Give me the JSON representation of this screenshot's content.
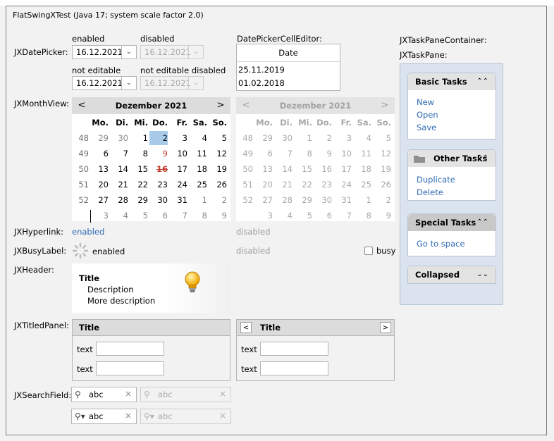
{
  "window": {
    "title": "FlatSwingXTest (Java 17;  system scale factor 2.0)"
  },
  "labels": {
    "datepicker": "JXDatePicker:",
    "monthview": "JXMonthView:",
    "hyperlink": "JXHyperlink:",
    "busylabel": "JXBusyLabel:",
    "header": "JXHeader:",
    "titledpanel": "JXTitledPanel:",
    "searchfield": "JXSearchField:",
    "taskpanecontainer": "JXTaskPaneContainer:",
    "taskpane": "JXTaskPane:"
  },
  "datepicker": {
    "enabled_label": "enabled",
    "disabled_label": "disabled",
    "not_editable_label": "not editable",
    "not_editable_disabled_label": "not editable disabled",
    "value": "16.12.2021"
  },
  "cell_editor": {
    "label": "DatePickerCellEditor:",
    "header": "Date",
    "rows": [
      "25.11.2019",
      "01.02.2018"
    ]
  },
  "monthview": {
    "title": "Dezember 2021",
    "prev": "<",
    "next": ">",
    "days": [
      "Mo.",
      "Di.",
      "Mi.",
      "Do.",
      "Fr.",
      "Sa.",
      "So."
    ],
    "weeks": [
      [
        "48",
        "29",
        "30",
        "1",
        "2",
        "3",
        "4",
        "5"
      ],
      [
        "49",
        "6",
        "7",
        "8",
        "9",
        "10",
        "11",
        "12"
      ],
      [
        "50",
        "13",
        "14",
        "15",
        "16",
        "17",
        "18",
        "19"
      ],
      [
        "51",
        "20",
        "21",
        "22",
        "23",
        "24",
        "25",
        "26"
      ],
      [
        "52",
        "27",
        "28",
        "29",
        "30",
        "31",
        "1",
        "2"
      ],
      [
        "",
        "3",
        "4",
        "5",
        "6",
        "7",
        "8",
        "9"
      ]
    ]
  },
  "hyperlink": {
    "enabled": "enabled",
    "disabled": "disabled"
  },
  "busylabel": {
    "enabled": "enabled",
    "disabled": "disabled",
    "busy_label": "busy"
  },
  "header": {
    "title": "Title",
    "desc1": "Description",
    "desc2": "More description"
  },
  "titledpanel": {
    "title": "Title",
    "field_label": "text",
    "prev": "<",
    "next": ">"
  },
  "searchfield": {
    "value": "abc",
    "clear": "×"
  },
  "taskpanes": [
    {
      "title": "Basic Tasks",
      "toggle": "≈",
      "links": [
        "New",
        "Open",
        "Save"
      ]
    },
    {
      "title": "Other Tasks",
      "toggle": "≈",
      "links": [
        "Duplicate",
        "Delete"
      ]
    },
    {
      "title": "Special Tasks",
      "toggle": "≈",
      "links": [
        "Go to space"
      ]
    },
    {
      "title": "Collapsed",
      "toggle": "≈",
      "links": []
    }
  ]
}
